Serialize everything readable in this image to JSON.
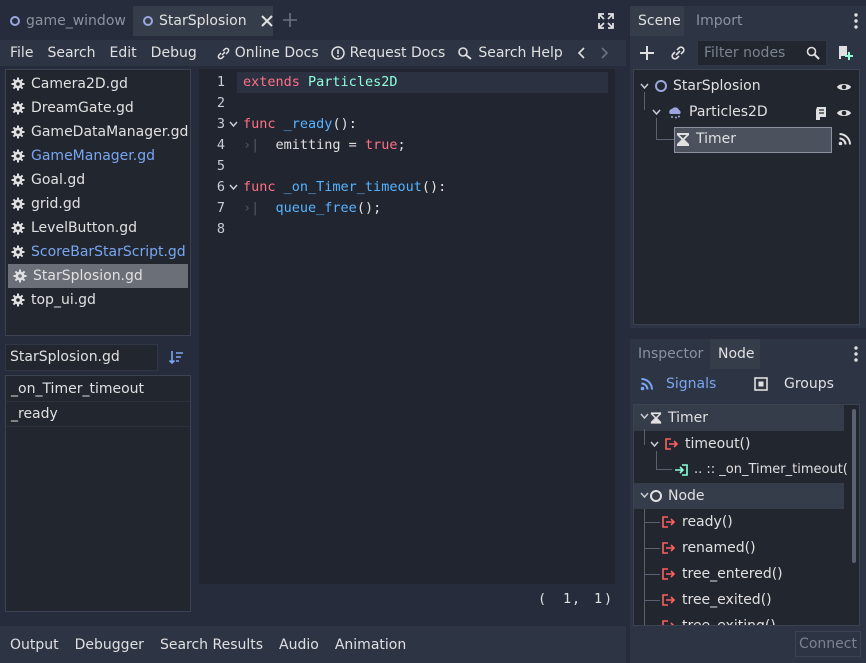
{
  "editor_tabs": [
    {
      "label": "game_window",
      "active": false
    },
    {
      "label": "StarSplosion",
      "active": true
    }
  ],
  "menu": [
    "File",
    "Search",
    "Edit",
    "Debug"
  ],
  "menu_buttons": [
    "Online Docs",
    "Request Docs",
    "Search Help"
  ],
  "scripts": [
    {
      "label": "Camera2D.gd"
    },
    {
      "label": "DreamGate.gd"
    },
    {
      "label": "GameDataManager.gd"
    },
    {
      "label": "GameManager.gd"
    },
    {
      "label": "Goal.gd"
    },
    {
      "label": "grid.gd"
    },
    {
      "label": "LevelButton.gd"
    },
    {
      "label": "ScoreBarStarScript.gd"
    },
    {
      "label": "StarSplosion.gd"
    },
    {
      "label": "top_ui.gd"
    }
  ],
  "current_script": "StarSplosion.gd",
  "methods": [
    "_on_Timer_timeout",
    "_ready"
  ],
  "code": {
    "line_numbers": [
      "1",
      "2",
      "3",
      "4",
      "5",
      "6",
      "7",
      "8"
    ],
    "l1_kw": "extends",
    "l1_type": "Particles2D",
    "l3_kw": "func",
    "l3_fn": "_ready",
    "l3_rest": "():",
    "l4_a": "emitting = ",
    "l4_kw": "true",
    "l4_b": ";",
    "l6_kw": "func",
    "l6_fn": "_on_Timer_timeout",
    "l6_rest": "():",
    "l7_fn": "queue_free",
    "l7_rest": "();"
  },
  "cursor": {
    "open": "(",
    "line": "1",
    "sep": ",",
    "col": "1",
    "close": ")"
  },
  "bottom_tabs": [
    "Output",
    "Debugger",
    "Search Results",
    "Audio",
    "Animation"
  ],
  "scene_dock": {
    "tabs": [
      "Scene",
      "Import"
    ],
    "filter_placeholder": "Filter nodes",
    "nodes": [
      "StarSplosion",
      "Particles2D",
      "Timer"
    ]
  },
  "node_dock": {
    "tabs": [
      "Inspector",
      "Node"
    ],
    "subtabs": [
      "Signals",
      "Groups"
    ],
    "timer_header": "Timer",
    "timer_signal": "timeout()",
    "connection": ".. :: _on_Timer_timeout(",
    "node_header": "Node",
    "node_signals": [
      "ready()",
      "renamed()",
      "tree_entered()",
      "tree_exited()",
      "tree_exiting()"
    ],
    "connect_label": "Connect"
  },
  "colors": {
    "background": "#262c3b",
    "accent": "#7aa6f0",
    "keyword": "#ff7085",
    "type": "#8effda",
    "function": "#57b3ff",
    "signal": "#ff5f5f"
  },
  "icons": [
    "circle-node-icon",
    "close-icon",
    "plus-icon",
    "fullscreen-icon",
    "link-icon",
    "info-icon",
    "search-help-icon",
    "gear-icon",
    "sort-icon",
    "search-icon",
    "eye-icon",
    "script-icon",
    "hourglass-icon",
    "signal-icon",
    "particles-icon",
    "groups-icon",
    "more-icon",
    "signal-out-icon",
    "connection-in-icon"
  ]
}
